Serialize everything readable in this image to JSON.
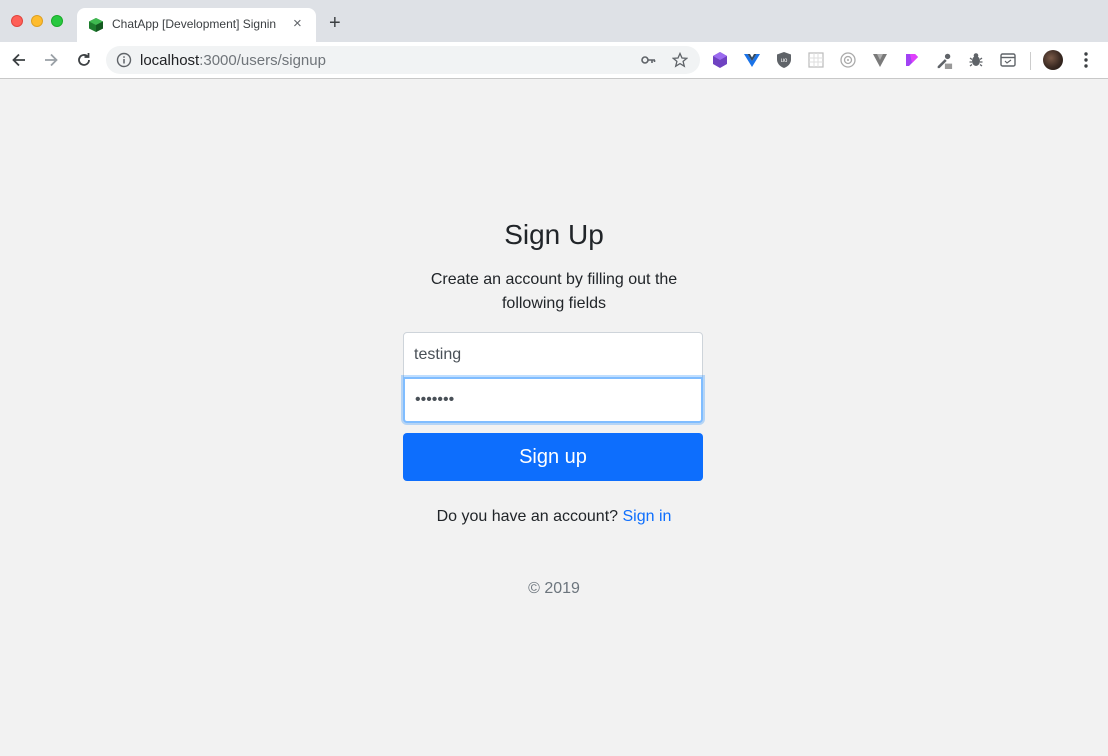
{
  "browser": {
    "tab": {
      "title": "ChatApp [Development] Signin",
      "close": "×"
    },
    "new_tab": "+",
    "address": {
      "host": "localhost",
      "rest": ":3000/users/signup"
    },
    "extensions": [
      "purple-cube-ext-icon",
      "vue-devtools-icon",
      "ublock-icon",
      "grid-ext-icon",
      "target-ext-icon",
      "vuetify-ext-icon",
      "react-ext-icon",
      "eyedropper-ext-icon",
      "bug-ext-icon",
      "window-ext-icon"
    ]
  },
  "page": {
    "title": "Sign Up",
    "description": "Create an account by filling out the following fields",
    "username_value": "testing",
    "password_value": "•••••••",
    "submit_label": "Sign up",
    "account_prompt": "Do you have an account?",
    "signin_link": "Sign in",
    "copyright": "© 2019"
  },
  "colors": {
    "primary": "#0d6efd",
    "background": "#f2f2f2",
    "focus_border": "#80bdff"
  }
}
